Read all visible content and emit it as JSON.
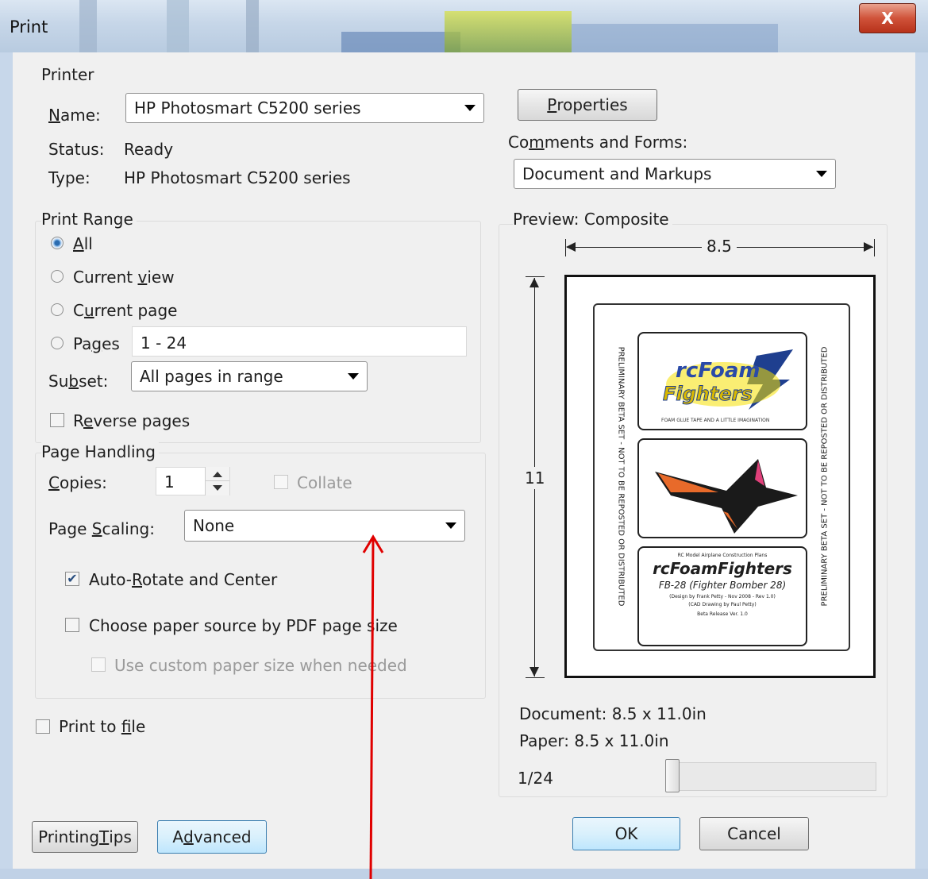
{
  "window": {
    "title": "Print",
    "close_glyph": "X"
  },
  "printer": {
    "group_label": "Printer",
    "name_label": "Name:",
    "name_value": "HP Photosmart C5200 series",
    "status_label": "Status:",
    "status_value": "Ready",
    "type_label": "Type:",
    "type_value": "HP Photosmart C5200 series",
    "properties_button": "Properties",
    "comments_label": "Comments and Forms:",
    "comments_value": "Document and Markups"
  },
  "print_range": {
    "group_label": "Print Range",
    "options": [
      "All",
      "Current view",
      "Current page",
      "Pages"
    ],
    "selected": "All",
    "pages_value": "1 - 24",
    "subset_label": "Subset:",
    "subset_value": "All pages in range",
    "reverse_label": "Reverse pages",
    "reverse_checked": false
  },
  "page_handling": {
    "group_label": "Page Handling",
    "copies_label": "Copies:",
    "copies_value": "1",
    "collate_label": "Collate",
    "scaling_label": "Page Scaling:",
    "scaling_value": "None",
    "auto_rotate_label": "Auto-Rotate and Center",
    "auto_rotate_checked": true,
    "paper_source_label": "Choose paper source by PDF page size",
    "paper_source_checked": false,
    "custom_paper_label": "Use custom paper size when needed",
    "custom_paper_checked": false
  },
  "print_to_file": {
    "label": "Print to file",
    "checked": false
  },
  "preview": {
    "label": "Preview: Composite",
    "width_label": "8.5",
    "height_label": "11",
    "document_size": "Document: 8.5 x 11.0in",
    "paper_size": "Paper: 8.5 x 11.0in",
    "page_indicator": "1/24",
    "page_content": {
      "side_text": "PRELIMINARY BETA SET - NOT TO BE REPOSTED OR DISTRIBUTED",
      "logo_top": "rcFoam",
      "logo_bottom": "Fighters",
      "tagline": "FOAM GLUE TAPE AND A LITTLE IMAGINATION",
      "header_small": "RC Model Airplane Construction Plans",
      "title": "rcFoamFighters",
      "subtitle": "FB-28 (Fighter Bomber 28)",
      "credit1": "(Design by Frank Petty - Nov 2008 - Rev 1.0)",
      "credit2": "(CAD Drawing by Paul Petty)",
      "release": "Beta Release Ver. 1.0"
    }
  },
  "buttons": {
    "printing_tips": "Printing Tips",
    "advanced": "Advanced",
    "ok": "OK",
    "cancel": "Cancel"
  },
  "colors": {
    "annotation_arrow": "#e00000",
    "titlebar": "#c6d6e8",
    "close_button": "#d0533a"
  }
}
